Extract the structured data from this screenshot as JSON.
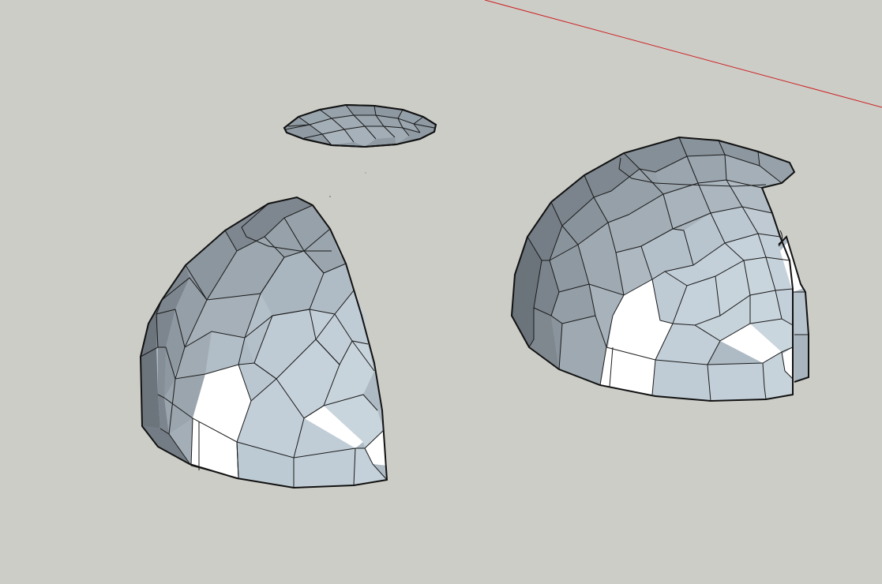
{
  "viewport": {
    "background": "#cdcdc8",
    "axis_color": "#cc2222",
    "face_colors": {
      "dark": "#6f7880",
      "mid_dark": "#8b959d",
      "mid": "#a3aeb7",
      "light": "#bccbd5",
      "lightest": "#c8d5de",
      "highlight": "#ffffff"
    }
  },
  "scene_objects": [
    {
      "name": "floating-disc"
    },
    {
      "name": "left-dome-segment"
    },
    {
      "name": "right-dome-segment"
    }
  ]
}
